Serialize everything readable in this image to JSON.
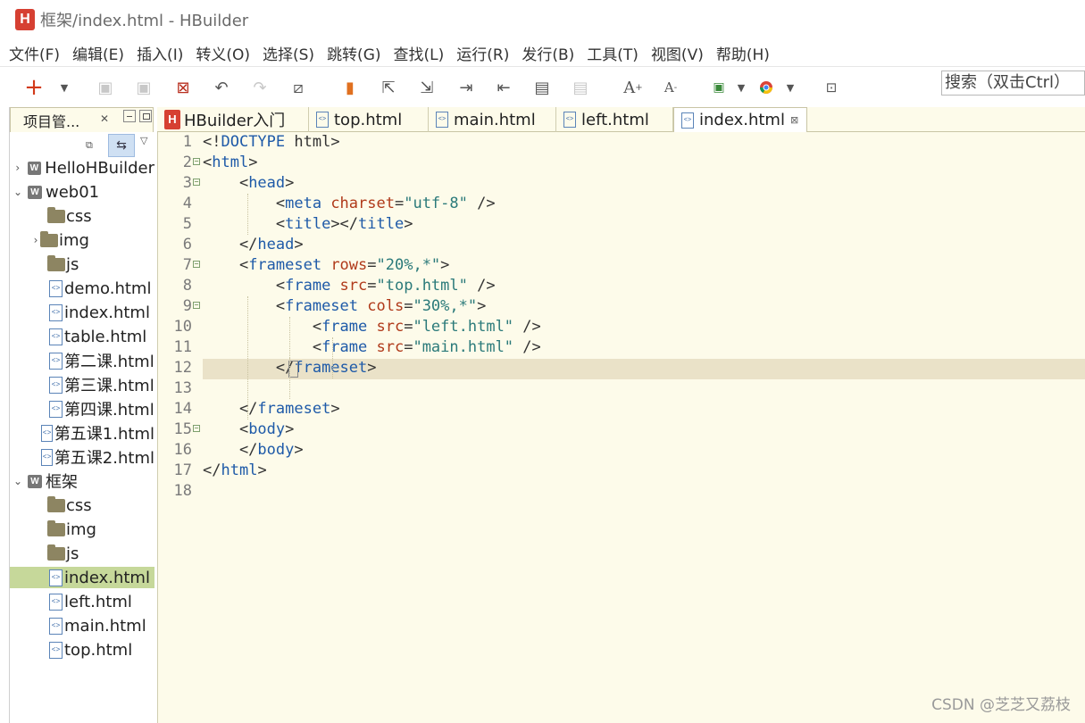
{
  "window": {
    "title": "框架/index.html  -  HBuilder",
    "logo_letter": "H"
  },
  "menu": [
    "文件(F)",
    "编辑(E)",
    "插入(I)",
    "转义(O)",
    "选择(S)",
    "跳转(G)",
    "查找(L)",
    "运行(R)",
    "发行(B)",
    "工具(T)",
    "视图(V)",
    "帮助(H)"
  ],
  "toolbar": {
    "search_placeholder": "搜索（双击Ctrl）",
    "icons": [
      "new-icon",
      "dropdown-icon",
      "save-icon",
      "save-all-icon",
      "close-file-icon",
      "undo-icon",
      "redo-icon",
      "format-icon",
      "bookmark-icon",
      "goto-icon",
      "goto-end-icon",
      "indent-icon",
      "outdent-icon",
      "comment-icon",
      "uncomment-icon",
      "font-increase-icon",
      "font-decrease-icon",
      "run-icon",
      "dropdown-icon",
      "browser-chrome-icon",
      "dropdown-icon",
      "info-icon"
    ]
  },
  "project_panel": {
    "title": "项目管...",
    "tree": [
      {
        "label": "HelloHBuilder",
        "type": "project",
        "expanded": false
      },
      {
        "label": "web01",
        "type": "project",
        "expanded": true
      },
      {
        "label": "css",
        "type": "folder"
      },
      {
        "label": "img",
        "type": "folder",
        "expandable": true
      },
      {
        "label": "js",
        "type": "folder"
      },
      {
        "label": "demo.html",
        "type": "file"
      },
      {
        "label": "index.html",
        "type": "file"
      },
      {
        "label": "table.html",
        "type": "file"
      },
      {
        "label": "第二课.html",
        "type": "file"
      },
      {
        "label": "第三课.html",
        "type": "file"
      },
      {
        "label": "第四课.html",
        "type": "file"
      },
      {
        "label": "第五课1.html",
        "type": "file"
      },
      {
        "label": "第五课2.html",
        "type": "file"
      },
      {
        "label": "框架",
        "type": "project",
        "expanded": true
      },
      {
        "label": "css",
        "type": "folder"
      },
      {
        "label": "img",
        "type": "folder"
      },
      {
        "label": "js",
        "type": "folder"
      },
      {
        "label": "index.html",
        "type": "file",
        "selected": true
      },
      {
        "label": "left.html",
        "type": "file"
      },
      {
        "label": "main.html",
        "type": "file"
      },
      {
        "label": "top.html",
        "type": "file"
      }
    ]
  },
  "tabs": [
    {
      "label": "HBuilder入门",
      "kind": "hbuilder"
    },
    {
      "label": "top.html",
      "kind": "file"
    },
    {
      "label": "main.html",
      "kind": "file"
    },
    {
      "label": "left.html",
      "kind": "file"
    },
    {
      "label": "index.html",
      "kind": "file",
      "active": true
    }
  ],
  "editor": {
    "current_line": 12,
    "lines": [
      {
        "n": "1",
        "fold": false,
        "tokens": [
          [
            "p",
            "<!"
          ],
          [
            "t",
            "DOCTYPE"
          ],
          [
            "p",
            " html>"
          ]
        ]
      },
      {
        "n": "2",
        "fold": true,
        "tokens": [
          [
            "p",
            "<"
          ],
          [
            "t",
            "html"
          ],
          [
            "p",
            ">"
          ]
        ]
      },
      {
        "n": "3",
        "fold": true,
        "tokens": [
          [
            "p",
            "    <"
          ],
          [
            "t",
            "head"
          ],
          [
            "p",
            ">"
          ]
        ]
      },
      {
        "n": "4",
        "fold": false,
        "tokens": [
          [
            "p",
            "        <"
          ],
          [
            "t",
            "meta "
          ],
          [
            "a",
            "charset"
          ],
          [
            "p",
            "="
          ],
          [
            "v",
            "\"utf-8\""
          ],
          [
            "p",
            " />"
          ]
        ]
      },
      {
        "n": "5",
        "fold": false,
        "tokens": [
          [
            "p",
            "        <"
          ],
          [
            "t",
            "title"
          ],
          [
            "p",
            "></"
          ],
          [
            "t",
            "title"
          ],
          [
            "p",
            ">"
          ]
        ]
      },
      {
        "n": "6",
        "fold": false,
        "tokens": [
          [
            "p",
            "    </"
          ],
          [
            "t",
            "head"
          ],
          [
            "p",
            ">"
          ]
        ]
      },
      {
        "n": "7",
        "fold": true,
        "tokens": [
          [
            "p",
            "    <"
          ],
          [
            "t",
            "frameset "
          ],
          [
            "a",
            "rows"
          ],
          [
            "p",
            "="
          ],
          [
            "v",
            "\"20%,*\""
          ],
          [
            "p",
            ">"
          ]
        ]
      },
      {
        "n": "8",
        "fold": false,
        "tokens": [
          [
            "p",
            "        <"
          ],
          [
            "t",
            "frame "
          ],
          [
            "a",
            "src"
          ],
          [
            "p",
            "="
          ],
          [
            "v",
            "\"top.html\""
          ],
          [
            "p",
            " />"
          ]
        ]
      },
      {
        "n": "9",
        "fold": true,
        "tokens": [
          [
            "p",
            "        <"
          ],
          [
            "t",
            "frameset "
          ],
          [
            "a",
            "cols"
          ],
          [
            "p",
            "="
          ],
          [
            "v",
            "\"30%,*\""
          ],
          [
            "p",
            ">"
          ]
        ]
      },
      {
        "n": "10",
        "fold": false,
        "tokens": [
          [
            "p",
            "            <"
          ],
          [
            "t",
            "frame "
          ],
          [
            "a",
            "src"
          ],
          [
            "p",
            "="
          ],
          [
            "v",
            "\"left.html\""
          ],
          [
            "p",
            " />"
          ]
        ]
      },
      {
        "n": "11",
        "fold": false,
        "tokens": [
          [
            "p",
            "            <"
          ],
          [
            "t",
            "frame "
          ],
          [
            "a",
            "src"
          ],
          [
            "p",
            "="
          ],
          [
            "v",
            "\"main.html\""
          ],
          [
            "p",
            " />"
          ]
        ]
      },
      {
        "n": "12",
        "fold": false,
        "tokens": [
          [
            "p",
            "        </"
          ],
          [
            "t",
            "frameset"
          ],
          [
            "p",
            ">"
          ]
        ]
      },
      {
        "n": "13",
        "fold": false,
        "tokens": []
      },
      {
        "n": "14",
        "fold": false,
        "tokens": [
          [
            "p",
            "    </"
          ],
          [
            "t",
            "frameset"
          ],
          [
            "p",
            ">"
          ]
        ]
      },
      {
        "n": "15",
        "fold": true,
        "tokens": [
          [
            "p",
            "    <"
          ],
          [
            "t",
            "body"
          ],
          [
            "p",
            ">"
          ]
        ]
      },
      {
        "n": "16",
        "fold": false,
        "tokens": [
          [
            "p",
            "    </"
          ],
          [
            "t",
            "body"
          ],
          [
            "p",
            ">"
          ]
        ]
      },
      {
        "n": "17",
        "fold": false,
        "tokens": [
          [
            "p",
            "</"
          ],
          [
            "t",
            "html"
          ],
          [
            "p",
            ">"
          ]
        ]
      },
      {
        "n": "18",
        "fold": false,
        "tokens": []
      }
    ]
  },
  "watermark": "CSDN @芝芝又荔枝"
}
